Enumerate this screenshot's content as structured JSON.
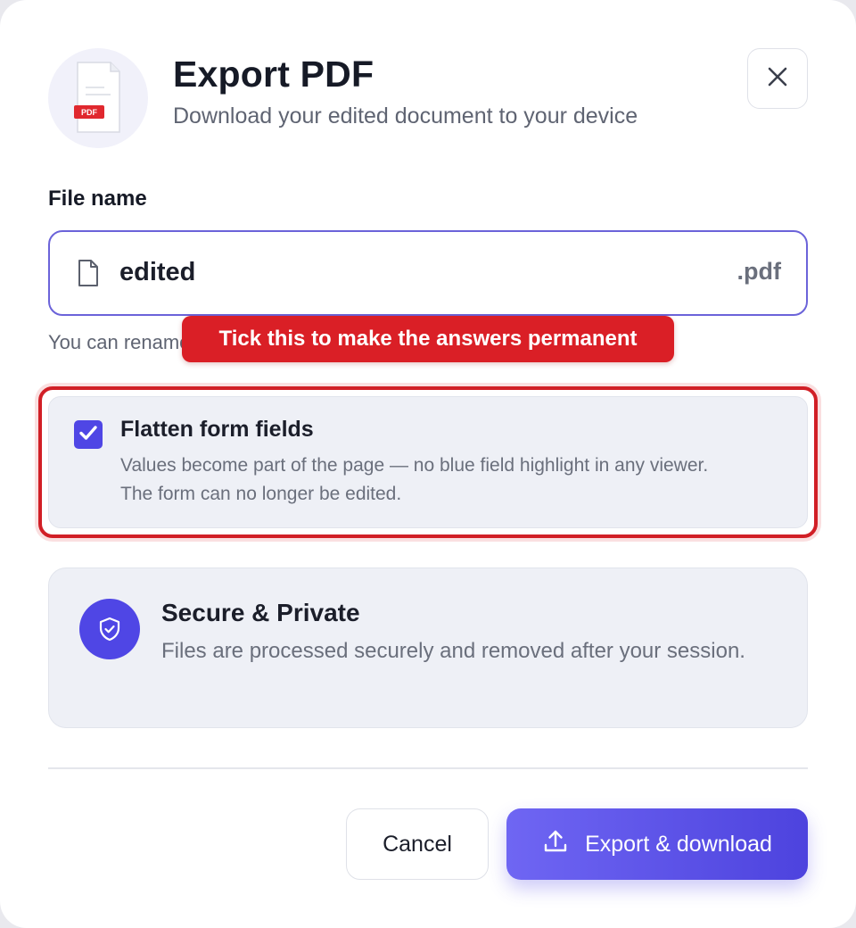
{
  "header": {
    "file_icon": "pdf-file-icon",
    "file_badge_text": "PDF",
    "title": "Export PDF",
    "subtitle": "Download your edited document to your device",
    "close_icon": "close-icon"
  },
  "file_name": {
    "label": "File name",
    "value": "edited",
    "extension": ".pdf",
    "helper_text": "You can rename"
  },
  "tooltip": {
    "text": "Tick this to make the answers permanent"
  },
  "flatten": {
    "checked": true,
    "title": "Flatten form fields",
    "description_line1": "Values become part of the page — no blue field highlight in any viewer.",
    "description_line2": "The form can no longer be edited."
  },
  "secure": {
    "icon": "shield-check-icon",
    "title": "Secure & Private",
    "description": "Files are processed securely and removed after your session."
  },
  "footer": {
    "cancel_label": "Cancel",
    "export_label": "Export & download",
    "export_icon": "upload-icon"
  },
  "colors": {
    "accent": "#4f46e5",
    "highlight_red": "#d11f26",
    "pdf_badge_red": "#e0282e",
    "text_dark": "#161a26",
    "text_muted": "#6a6f7c"
  }
}
